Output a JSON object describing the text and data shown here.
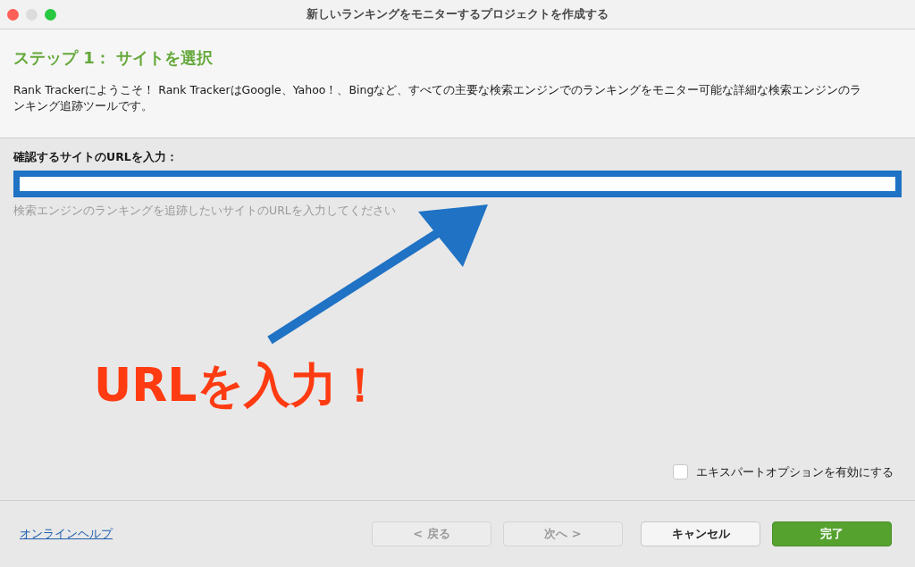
{
  "window": {
    "title": "新しいランキングをモニターするプロジェクトを作成する"
  },
  "header": {
    "step_title": "ステップ 1： サイトを選択",
    "description": "Rank Trackerにようこそ！ Rank TrackerはGoogle、Yahoo！、Bingなど、すべての主要な検索エンジンでのランキングをモニター可能な詳細な検索エンジンのランキング追跡ツールです。"
  },
  "url_field": {
    "label": "確認するサイトのURLを入力：",
    "focused": true,
    "hint": "検索エンジンのランキングを追跡したいサイトのURLを入力してください"
  },
  "annotation": {
    "text": "URLを入力！"
  },
  "expert_option": {
    "label": "エキスパートオプションを有効にする",
    "checked": false
  },
  "footer": {
    "help_link": "オンラインヘルプ",
    "buttons": [
      {
        "label": "< 戻る",
        "kind": "plain",
        "disabled": true
      },
      {
        "label": "次へ >",
        "kind": "plain",
        "disabled": true
      },
      {
        "label": "キャンセル",
        "kind": "plain",
        "disabled": false
      },
      {
        "label": "完了",
        "kind": "primary",
        "disabled": false
      }
    ]
  }
}
